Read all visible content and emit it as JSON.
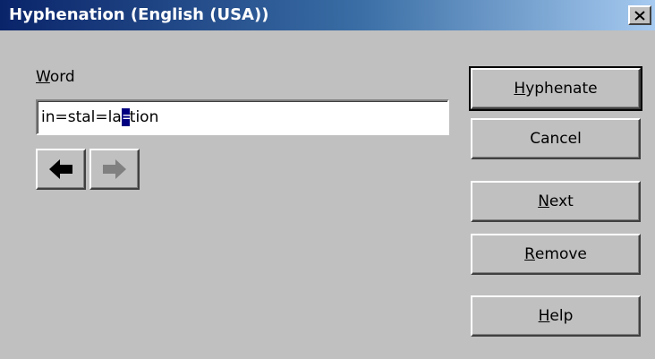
{
  "window": {
    "title": "Hyphenation (English (USA))"
  },
  "word": {
    "label_mnemonic": "W",
    "label_rest": "ord",
    "value_before": "in=stal=la",
    "value_selected": "=",
    "value_after": "tion"
  },
  "buttons": {
    "hyphenate": {
      "mnemonic": "H",
      "rest": "yphenate"
    },
    "cancel": {
      "label": "Cancel"
    },
    "next": {
      "mnemonic": "N",
      "rest": "ext"
    },
    "remove": {
      "mnemonic": "R",
      "rest": "emove"
    },
    "help": {
      "mnemonic": "H",
      "rest": "elp"
    }
  },
  "icons": {
    "close": "close-icon",
    "previous": "arrow-left-icon",
    "next": "arrow-right-icon"
  },
  "colors": {
    "titlebar_start": "#0a246a",
    "titlebar_end": "#a6caf0",
    "face": "#c0c0c0",
    "selection": "#000080"
  }
}
